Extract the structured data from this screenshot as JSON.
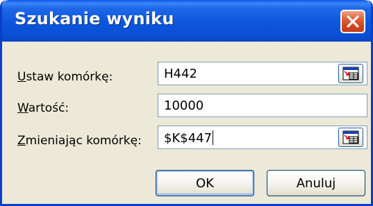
{
  "dialog": {
    "title": "Szukanie wyniku"
  },
  "fields": [
    {
      "label_ul": "U",
      "label_rest": "staw komórkę:",
      "value": "H442",
      "has_ref_button": true
    },
    {
      "label_ul": "W",
      "label_rest": "artość:",
      "value": "10000",
      "has_ref_button": false
    },
    {
      "label_ul": "Z",
      "label_rest": "mieniając komórkę:",
      "value": "$K$447",
      "has_ref_button": true
    }
  ],
  "buttons": {
    "ok": "OK",
    "cancel": "Anuluj"
  },
  "icons": {
    "close": "close-x-icon",
    "range_picker": "collapse-dialog-range-icon"
  }
}
